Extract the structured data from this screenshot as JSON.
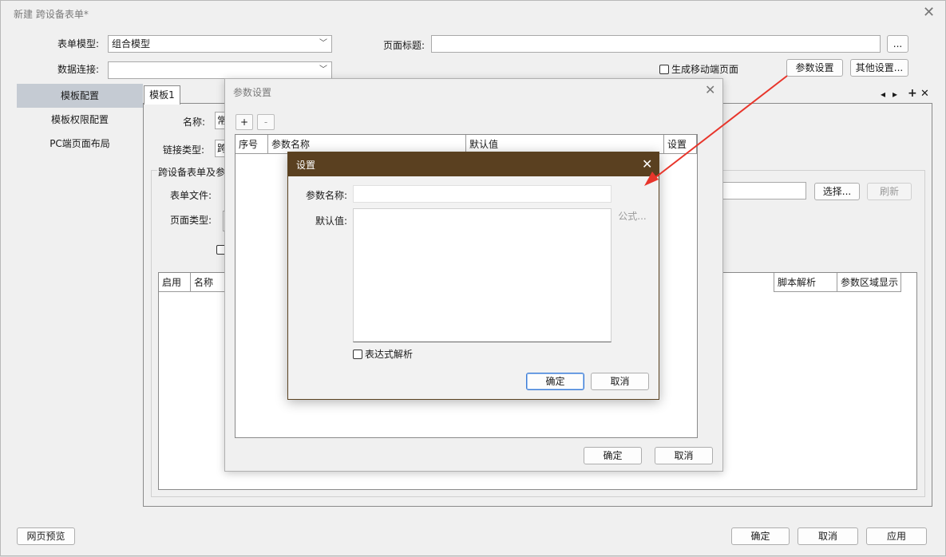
{
  "window": {
    "title": "新建 跨设备表单*"
  },
  "form": {
    "model_label": "表单模型:",
    "model_value": "组合模型",
    "datasource_label": "数据连接:",
    "datasource_value": "",
    "page_title_label": "页面标题:",
    "page_title_value": "",
    "browse_label": "...",
    "gen_mobile_label": "生成移动端页面",
    "param_settings_label": "参数设置",
    "other_settings_label": "其他设置..."
  },
  "sidebar": {
    "items": [
      {
        "label": "模板配置",
        "active": true
      },
      {
        "label": "模板权限配置",
        "active": false
      },
      {
        "label": "PC端页面布局",
        "active": false
      }
    ]
  },
  "template": {
    "tab_label": "模板1",
    "name_label": "名称:",
    "name_value": "常",
    "link_type_label": "链接类型:",
    "link_type_value": "跨",
    "group_title": "跨设备表单及参",
    "form_file_label": "表单文件:",
    "page_type_label": "页面类型:",
    "select_label": "选择...",
    "refresh_label": "刷新",
    "table_headers": [
      "启用",
      "名称",
      "脚本解析",
      "参数区域显示"
    ]
  },
  "param_dialog": {
    "title": "参数设置",
    "add_label": "+",
    "remove_label": "-",
    "headers": [
      "序号",
      "参数名称",
      "默认值",
      "设置"
    ],
    "ok_label": "确定",
    "cancel_label": "取消"
  },
  "settings_dialog": {
    "title": "设置",
    "param_name_label": "参数名称:",
    "param_name_value": "",
    "default_label": "默认值:",
    "default_value": "",
    "formula_label": "公式...",
    "expr_label": "表达式解析",
    "ok_label": "确定",
    "cancel_label": "取消"
  },
  "footer": {
    "preview_label": "网页预览",
    "ok_label": "确定",
    "cancel_label": "取消",
    "apply_label": "应用"
  },
  "colors": {
    "settings_header": "#5a4020",
    "annotation_arrow": "#e8352b",
    "sidebar_active": "#c5cbd3"
  }
}
